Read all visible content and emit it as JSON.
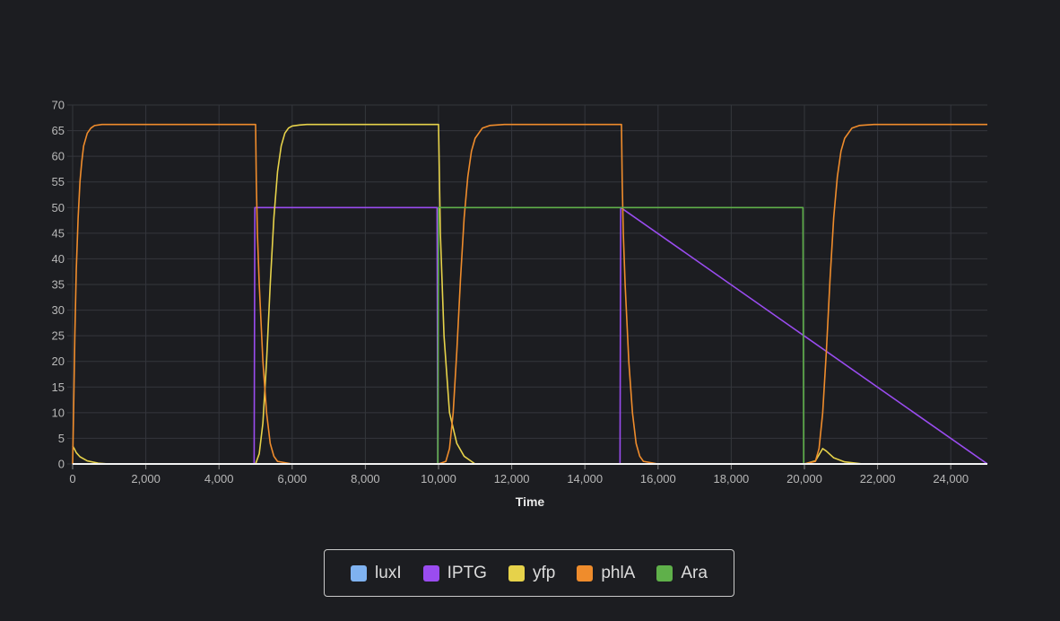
{
  "chart_data": {
    "type": "line",
    "title": "",
    "xlabel": "Time",
    "ylabel": "",
    "xlim": [
      0,
      25000
    ],
    "ylim": [
      0,
      70
    ],
    "x_ticks": [
      0,
      2000,
      4000,
      6000,
      8000,
      10000,
      12000,
      14000,
      16000,
      18000,
      20000,
      22000,
      24000
    ],
    "x_tick_labels": [
      "0",
      "2,000",
      "4,000",
      "6,000",
      "8,000",
      "10,000",
      "12,000",
      "14,000",
      "16,000",
      "18,000",
      "20,000",
      "22,000",
      "24,000"
    ],
    "y_ticks": [
      0,
      5,
      10,
      15,
      20,
      25,
      30,
      35,
      40,
      45,
      50,
      55,
      60,
      65,
      70
    ],
    "y_tick_labels": [
      "0",
      "5",
      "10",
      "15",
      "20",
      "25",
      "30",
      "35",
      "40",
      "45",
      "50",
      "55",
      "60",
      "65",
      "70"
    ],
    "grid": true,
    "legend_position": "bottom",
    "series": [
      {
        "name": "luxI",
        "color": "#7fb2f0",
        "x": [
          0,
          25000
        ],
        "values": [
          0,
          0
        ]
      },
      {
        "name": "IPTG",
        "color": "#9a4cf0",
        "x": [
          0,
          4960,
          4980,
          9960,
          9980,
          14960,
          14980,
          25000
        ],
        "values": [
          0,
          0,
          50,
          50,
          0,
          0,
          50,
          0
        ]
      },
      {
        "name": "yfp",
        "color": "#e6d24a",
        "x": [
          0,
          50,
          100,
          200,
          400,
          700,
          1000,
          5000,
          5100,
          5200,
          5300,
          5400,
          5500,
          5600,
          5700,
          5800,
          5900,
          6000,
          6200,
          6400,
          6600,
          7000,
          10000,
          10050,
          10150,
          10300,
          10500,
          10700,
          11000,
          20000,
          20300,
          20450,
          20500,
          20600,
          20800,
          21100,
          21600,
          25000
        ],
        "values": [
          3.5,
          2.9,
          2.2,
          1.4,
          0.6,
          0.15,
          0,
          0,
          2,
          8,
          20,
          35,
          48,
          57,
          62,
          64.5,
          65.5,
          65.9,
          66.1,
          66.2,
          66.2,
          66.2,
          66.2,
          45,
          25,
          10,
          4,
          1.5,
          0,
          0,
          0.6,
          2.4,
          3,
          2.5,
          1.2,
          0.4,
          0,
          0
        ]
      },
      {
        "name": "phlA",
        "color": "#ef8c2c",
        "x": [
          0,
          30,
          60,
          100,
          150,
          200,
          250,
          300,
          400,
          500,
          600,
          800,
          1000,
          5000,
          5020,
          5050,
          5100,
          5200,
          5300,
          5400,
          5500,
          5600,
          6000,
          10000,
          10200,
          10300,
          10400,
          10500,
          10600,
          10700,
          10800,
          10900,
          11000,
          11200,
          11400,
          11800,
          12000,
          15000,
          15020,
          15050,
          15100,
          15200,
          15300,
          15400,
          15500,
          15600,
          16000,
          20000,
          20300,
          20400,
          20500,
          20600,
          20700,
          20800,
          20900,
          21000,
          21100,
          21300,
          21500,
          21900,
          22200,
          25000
        ],
        "values": [
          0,
          12,
          25,
          38,
          48,
          55,
          59,
          62,
          64.5,
          65.5,
          66,
          66.2,
          66.2,
          66.2,
          55,
          45,
          35,
          20,
          10,
          4,
          1.5,
          0.5,
          0,
          0,
          0.5,
          3,
          10,
          22,
          36,
          48,
          56,
          61,
          63.5,
          65.5,
          66,
          66.2,
          66.2,
          66.2,
          55,
          45,
          35,
          20,
          10,
          4,
          1.5,
          0.5,
          0,
          0,
          0.5,
          3,
          10,
          22,
          36,
          48,
          56,
          61,
          63.5,
          65.5,
          66,
          66.2,
          66.2,
          66.2
        ]
      },
      {
        "name": "Ara",
        "color": "#5fb04a",
        "x": [
          0,
          9980,
          10000,
          19960,
          19980,
          25000
        ],
        "values": [
          0,
          0,
          50,
          50,
          0,
          0
        ]
      }
    ]
  },
  "legend": {
    "items": [
      {
        "label": "luxI",
        "color": "#7fb2f0"
      },
      {
        "label": "IPTG",
        "color": "#9a4cf0"
      },
      {
        "label": "yfp",
        "color": "#e6d24a"
      },
      {
        "label": "phlA",
        "color": "#ef8c2c"
      },
      {
        "label": "Ara",
        "color": "#5fb04a"
      }
    ]
  }
}
